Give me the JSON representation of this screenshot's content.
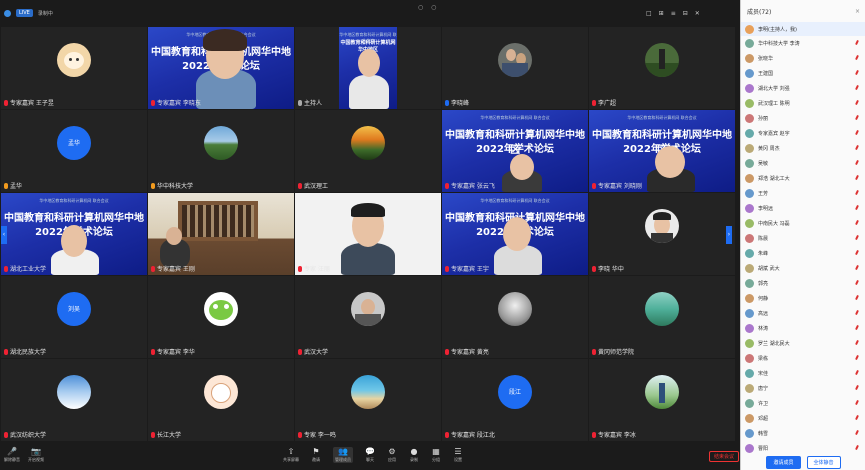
{
  "topbar": {
    "live_badge": "LIVE",
    "rec_text": "录制中",
    "center_text": "○ ○",
    "right_items": [
      "□",
      "⊞",
      "≡",
      "⊟",
      "✕"
    ]
  },
  "slide": {
    "line1": "华中地区教育和科研计算机网 联合会议",
    "line2": "中国教育和科研计算机网华中地区",
    "line3": "2022年学术论坛",
    "line4": "主办单位"
  },
  "tiles": [
    {
      "label": "专家嘉宾 王子昱"
    },
    {
      "label": "专家嘉宾 李晓东"
    },
    {
      "label": "主持人"
    },
    {
      "label": "李晓峰"
    },
    {
      "label": "李广超"
    },
    {
      "label": "孟华",
      "initials": "孟华"
    },
    {
      "label": "华中科技大学"
    },
    {
      "label": "武汉理工"
    },
    {
      "label": "专家嘉宾 张云飞"
    },
    {
      "label": "专家嘉宾 刘晓刚"
    },
    {
      "label": "湖北工业大学"
    },
    {
      "label": "专家嘉宾 王刚"
    },
    {
      "label": "专家 汪丽"
    },
    {
      "label": "专家嘉宾 王宇"
    },
    {
      "label": "李晓 华中"
    },
    {
      "label": "湖北民族大学",
      "initials": "刘吴"
    },
    {
      "label": "专家嘉宾 李华"
    },
    {
      "label": "武汉大学"
    },
    {
      "label": "专家嘉宾 黄亮"
    },
    {
      "label": "黄冈师范学院"
    },
    {
      "label": "武汉纺织大学"
    },
    {
      "label": "长江大学"
    },
    {
      "label": "专家 李一鸣"
    },
    {
      "label": "专家嘉宾 段江北",
      "initials": "段江"
    },
    {
      "label": "专家嘉宾 李冰"
    }
  ],
  "sidebar": {
    "title": "成员(72)",
    "close": "×",
    "self_label": "李明(主持人，我)",
    "members": [
      "华中科技大学 李涛",
      "张晓华",
      "王建国",
      "湖北大学 刘强",
      "武汉理工 陈明",
      "孙丽",
      "专家嘉宾 赵宇",
      "黄冈 周杰",
      "吴敏",
      "郑浩 湖北工大",
      "王芳",
      "李明远",
      "中南民大 冯磊",
      "陈晨",
      "朱峰",
      "胡斌 武大",
      "郭亮",
      "何静",
      "高远",
      "林涛",
      "罗兰 湖北民大",
      "梁栋",
      "宋佳",
      "唐宁",
      "许卫",
      "邓超",
      "韩雪",
      "曹阳"
    ],
    "invite_label": "邀请成员",
    "mute_all_label": "全体静音"
  },
  "toolbar": {
    "left": [
      {
        "icon": "🎤",
        "label": "解除静音"
      },
      {
        "icon": "📷",
        "label": "开启视频"
      }
    ],
    "center": [
      {
        "icon": "⇧",
        "label": "共享屏幕"
      },
      {
        "icon": "⚑",
        "label": "邀请"
      },
      {
        "icon": "👥",
        "label": "管理成员"
      },
      {
        "icon": "💬",
        "label": "聊天"
      },
      {
        "icon": "⚙",
        "label": "应用"
      },
      {
        "icon": "●",
        "label": "录制"
      },
      {
        "icon": "▦",
        "label": "分组"
      },
      {
        "icon": "☰",
        "label": "设置"
      }
    ],
    "end_label": "结束会议"
  },
  "colors": {
    "accent": "#1e6cf2",
    "danger": "#e23333",
    "tile_bg": "#232323",
    "slide_blue": "#1d2fa8"
  }
}
